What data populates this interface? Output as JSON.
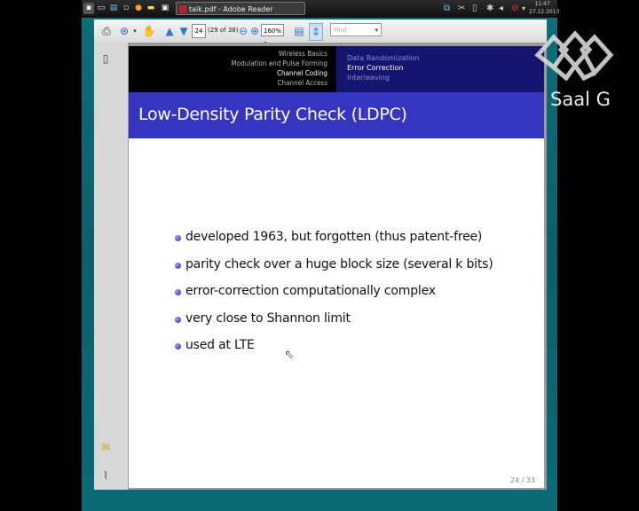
{
  "taskbar": {
    "window_title": "talk.pdf - Adobe Reader",
    "clock_time": "11:47",
    "clock_date": "27.12.2013"
  },
  "toolbar": {
    "page_current": "24",
    "page_of": "(29 of 38)",
    "zoom": "160%",
    "find_placeholder": "Find"
  },
  "slide": {
    "sections": [
      "Wireless Basics",
      "Modulation and Pulse Forming",
      "Channel Coding",
      "Channel Access"
    ],
    "current_section": "Channel Coding",
    "subsections": [
      "Data Randomization",
      "Error Correction",
      "Interleaving"
    ],
    "current_subsection": "Error Correction",
    "title": "Low-Density Parity Check (LDPC)",
    "bullets": [
      "developed 1963, but forgotten (thus patent-free)",
      "parity check over a huge block size (several k bits)",
      "error-correction computationally complex",
      "very close to Shannon limit",
      "used at LTE"
    ],
    "page_number": "24 / 33"
  },
  "logo": {
    "text": "Saal G"
  },
  "colors": {
    "header_dark_blue": "#151570",
    "title_blue": "#3535c0",
    "desktop_teal": "#0e6f7a"
  }
}
